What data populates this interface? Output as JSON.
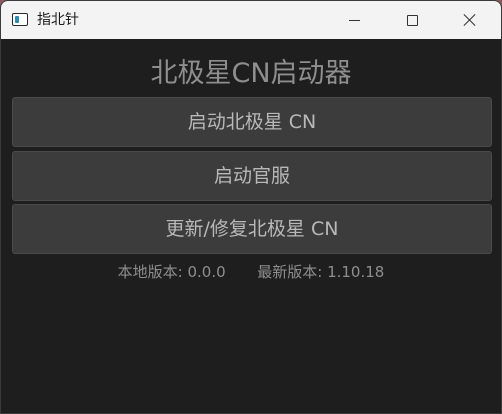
{
  "window": {
    "title": "指北针"
  },
  "main": {
    "heading": "北极星CN启动器",
    "buttons": {
      "launch": "启动北极星 CN",
      "launch_official": "启动官服",
      "update_repair": "更新/修复北极星 CN"
    },
    "versions": {
      "local_label": "本地版本:",
      "local_value": "0.0.0",
      "latest_label": "最新版本:",
      "latest_value": "1.10.18"
    }
  },
  "colors": {
    "window_bg": "#1e1e1e",
    "titlebar_bg": "#f3f3f3",
    "button_bg": "#3c3c3c",
    "text_muted": "#8e8e8e"
  }
}
